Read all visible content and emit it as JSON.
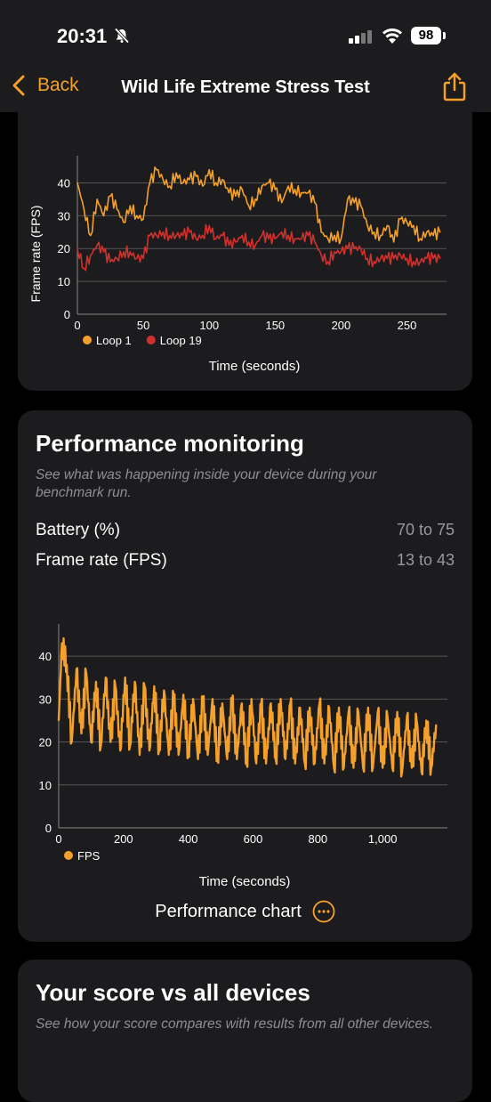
{
  "status_bar": {
    "time": "20:31",
    "battery": "98"
  },
  "nav": {
    "back_label": "Back",
    "title": "Wild Life Extreme Stress Test"
  },
  "stress_chart": {
    "ylabel": "Frame rate (FPS)",
    "xlabel": "Time (seconds)",
    "legend": [
      "Loop 1",
      "Loop 19"
    ]
  },
  "performance": {
    "title": "Performance monitoring",
    "description": "See what was happening inside your device during your benchmark run.",
    "stats": [
      {
        "label": "Battery (%)",
        "value": "70 to 75"
      },
      {
        "label": "Frame rate (FPS)",
        "value": "13 to 43"
      }
    ],
    "chart_link_label": "Performance chart",
    "legend": [
      "FPS"
    ],
    "xlabel": "Time (seconds)"
  },
  "score": {
    "title": "Your score vs all devices",
    "description": "See how your score compares with results from all other devices."
  },
  "colors": {
    "accent": "#f5a02a",
    "loop19": "#d0312d",
    "card": "#1c1c1e"
  },
  "chart_data": [
    {
      "type": "line",
      "xlabel": "Time (seconds)",
      "ylabel": "Frame rate (FPS)",
      "xlim": [
        0,
        280
      ],
      "ylim": [
        0,
        45
      ],
      "xticks": [
        "0",
        "50",
        "100",
        "150",
        "200",
        "250"
      ],
      "yticks": [
        "0",
        "10",
        "20",
        "30",
        "40"
      ],
      "series": [
        {
          "name": "Loop 1",
          "color": "#f5a02a",
          "x": [
            0,
            5,
            10,
            15,
            20,
            25,
            30,
            35,
            40,
            45,
            50,
            55,
            60,
            65,
            70,
            75,
            80,
            85,
            90,
            95,
            100,
            105,
            110,
            115,
            120,
            125,
            130,
            135,
            140,
            145,
            150,
            155,
            160,
            165,
            170,
            175,
            180,
            185,
            190,
            195,
            200,
            205,
            210,
            215,
            220,
            225,
            230,
            235,
            240,
            245,
            250,
            255,
            260,
            265,
            270,
            275
          ],
          "values": [
            40,
            32,
            24,
            35,
            30,
            36,
            32,
            28,
            33,
            30,
            29,
            40,
            44,
            41,
            39,
            43,
            40,
            41,
            42,
            39,
            44,
            40,
            41,
            37,
            36,
            38,
            33,
            35,
            39,
            40,
            38,
            34,
            39,
            38,
            37,
            37,
            34,
            25,
            23,
            24,
            23,
            35,
            34,
            33,
            27,
            25,
            24,
            27,
            22,
            29,
            28,
            27,
            23,
            25,
            24,
            25
          ]
        },
        {
          "name": "Loop 19",
          "color": "#d0312d",
          "x": [
            0,
            5,
            10,
            15,
            20,
            25,
            30,
            35,
            40,
            45,
            50,
            55,
            60,
            65,
            70,
            75,
            80,
            85,
            90,
            95,
            100,
            105,
            110,
            115,
            120,
            125,
            130,
            135,
            140,
            145,
            150,
            155,
            160,
            165,
            170,
            175,
            180,
            185,
            190,
            195,
            200,
            205,
            210,
            215,
            220,
            225,
            230,
            235,
            240,
            245,
            250,
            255,
            260,
            265,
            270,
            275
          ],
          "values": [
            20,
            14,
            18,
            21,
            19,
            16,
            17,
            19,
            19,
            17,
            17,
            24,
            24,
            25,
            24,
            24,
            24,
            25,
            23,
            24,
            27,
            23,
            24,
            21,
            22,
            24,
            22,
            21,
            24,
            23,
            23,
            25,
            24,
            23,
            23,
            24,
            22,
            18,
            16,
            19,
            19,
            20,
            20,
            20,
            17,
            16,
            17,
            17,
            17,
            18,
            17,
            16,
            16,
            17,
            17,
            17
          ]
        }
      ]
    },
    {
      "type": "line",
      "xlabel": "Time (seconds)",
      "xlim": [
        0,
        1200
      ],
      "ylim": [
        0,
        45
      ],
      "xticks": [
        "0",
        "200",
        "400",
        "600",
        "800",
        "1,000"
      ],
      "yticks": [
        "0",
        "10",
        "20",
        "30",
        "40"
      ],
      "series": [
        {
          "name": "FPS",
          "color": "#f5a02a",
          "x": [
            0,
            10,
            25,
            40,
            55,
            70,
            85,
            100,
            115,
            130,
            145,
            160,
            175,
            190,
            205,
            220,
            235,
            250,
            265,
            280,
            295,
            310,
            325,
            340,
            355,
            370,
            385,
            400,
            415,
            430,
            445,
            460,
            475,
            490,
            505,
            520,
            535,
            550,
            565,
            580,
            595,
            610,
            625,
            640,
            655,
            670,
            685,
            700,
            715,
            730,
            745,
            760,
            775,
            790,
            805,
            820,
            835,
            850,
            865,
            880,
            895,
            910,
            925,
            940,
            955,
            970,
            985,
            1000,
            1015,
            1030,
            1045,
            1060,
            1075,
            1090,
            1105,
            1120,
            1135,
            1150,
            1165
          ],
          "values": [
            25,
            43,
            38,
            20,
            37,
            22,
            36,
            20,
            34,
            19,
            35,
            20,
            33,
            18,
            35,
            19,
            34,
            17,
            33,
            18,
            33,
            18,
            32,
            17,
            31,
            17,
            31,
            17,
            30,
            16,
            30,
            17,
            30,
            16,
            29,
            16,
            30,
            16,
            29,
            15,
            30,
            15,
            29,
            15,
            29,
            16,
            30,
            16,
            29,
            15,
            28,
            15,
            28,
            15,
            29,
            15,
            28,
            14,
            28,
            14,
            27,
            14,
            27,
            14,
            28,
            14,
            27,
            14,
            26,
            14,
            27,
            13,
            26,
            14,
            25,
            13,
            25,
            14,
            24
          ]
        }
      ]
    }
  ]
}
